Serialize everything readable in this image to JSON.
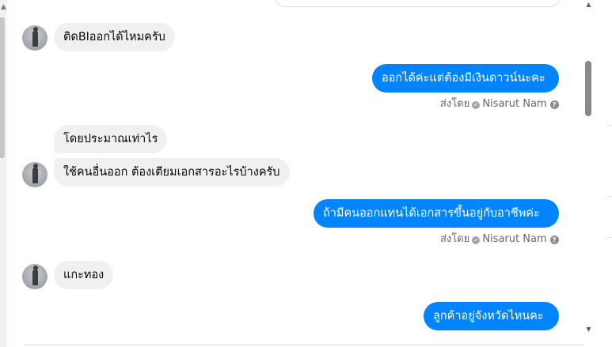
{
  "conversation": {
    "messages": [
      {
        "direction": "in",
        "text": "ติดBlออกได้ไหมครับ",
        "avatar": "contact-avatar"
      },
      {
        "direction": "out",
        "text": "ออกได้ค่ะแต่ต้องมีเงินดาวน์นะคะ",
        "sent_by_prefix": "ส่งโดย",
        "sent_by_name": "Nisarut Nam"
      },
      {
        "direction": "in",
        "text": "โดยประมาณเท่าไร"
      },
      {
        "direction": "in",
        "text": "ใช้คนอื่นออก ต้องเตียมเอกสารอะไรบ้างครับ",
        "avatar": "contact-avatar"
      },
      {
        "direction": "out",
        "text": "ถ้ามีคนออกแทนได้เอกสารขึ้นอยู่กับอาชีพค่ะ",
        "sent_by_prefix": "ส่งโดย",
        "sent_by_name": "Nisarut Nam"
      },
      {
        "direction": "in",
        "text": "แกะทอง",
        "avatar": "contact-avatar"
      },
      {
        "direction": "out",
        "text": "ลูกค้าอยู่จังหวัดไหนคะ"
      }
    ]
  },
  "icons": {
    "check": "check-circle-icon",
    "help": "question-circle-icon",
    "scroll_up": "triangle-up-icon",
    "scroll_down": "triangle-down-icon"
  },
  "colors": {
    "outgoing_bubble": "#0084ff",
    "incoming_bubble": "#f0f0f0",
    "meta_text": "#65676b"
  }
}
